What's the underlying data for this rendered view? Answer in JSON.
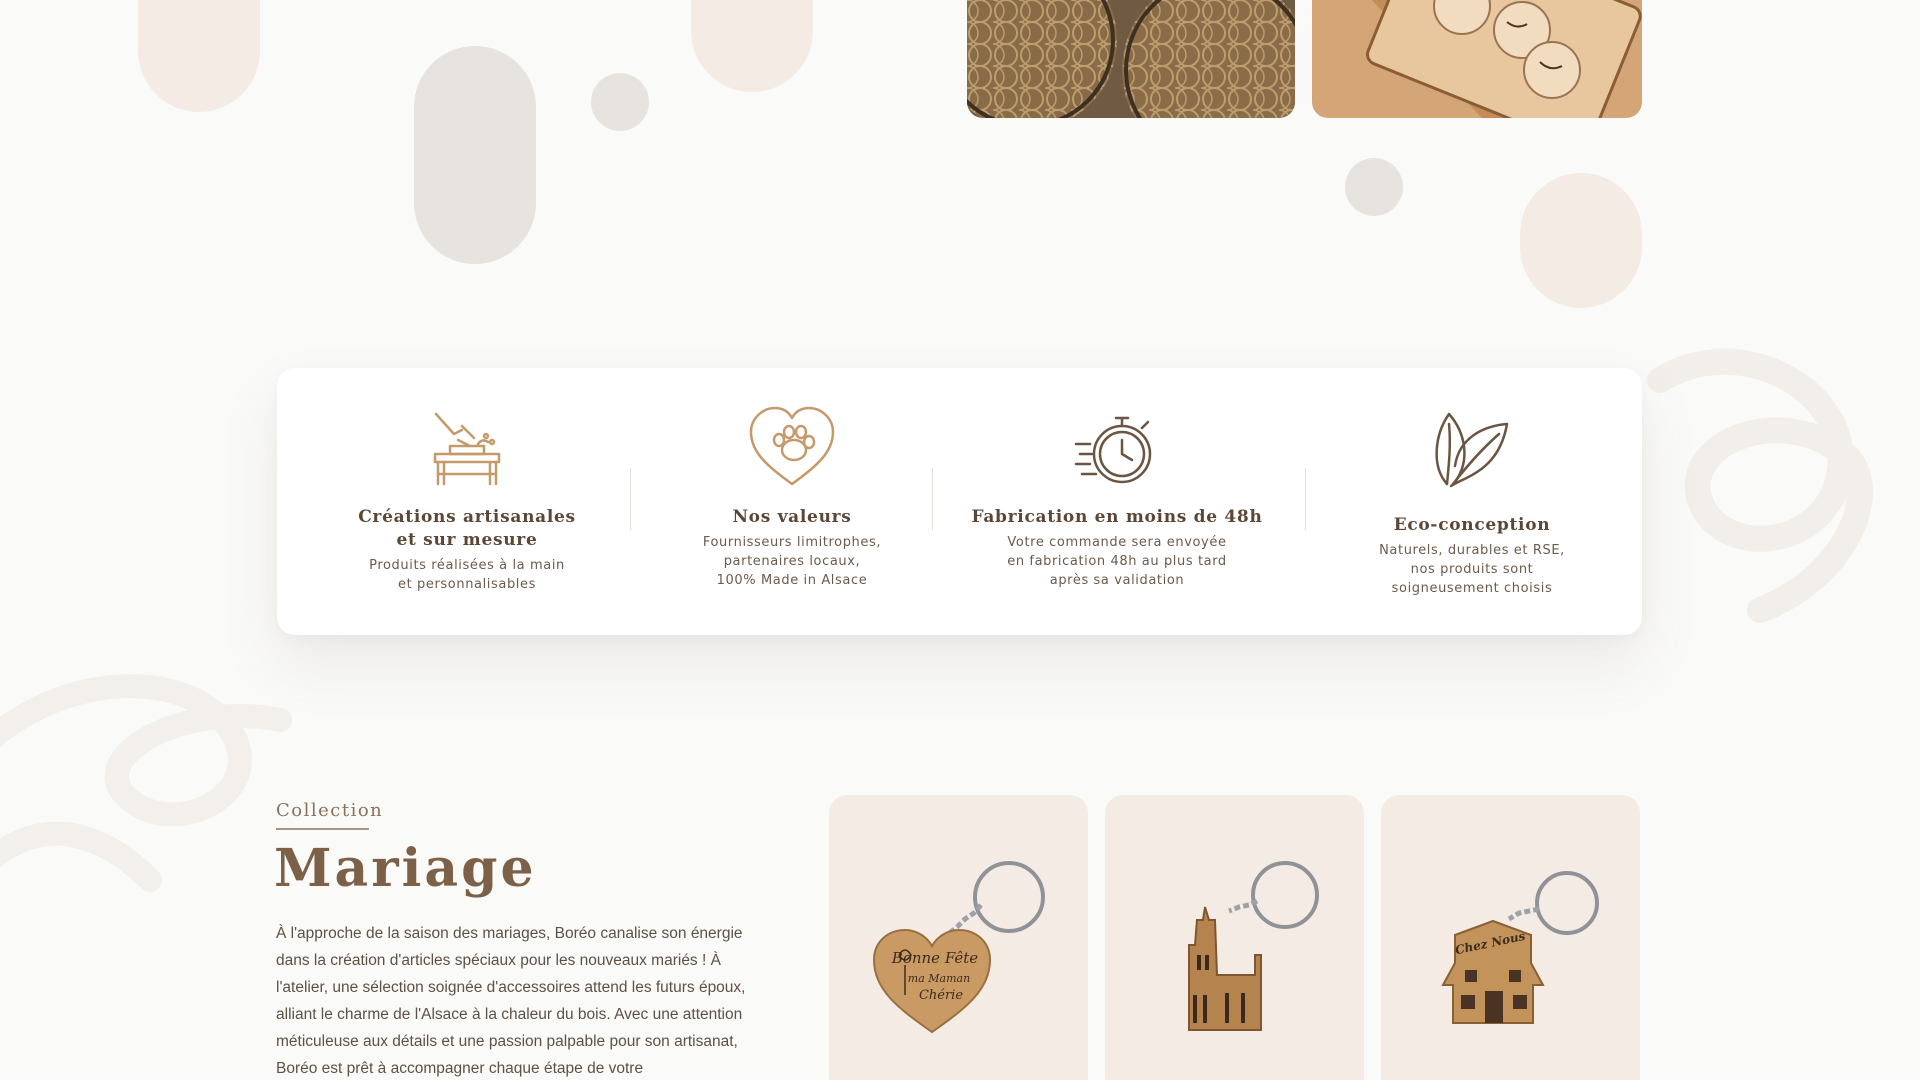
{
  "images": {
    "top_photo_1": "flower-of-life-wood-coasters",
    "top_photo_2": "engraved-wooden-tokens-in-tray"
  },
  "features": [
    {
      "icon": "carpentry-workbench-icon",
      "title": "Créations artisanales\net sur mesure",
      "text": "Produits réalisées à la main\net personnalisables"
    },
    {
      "icon": "heart-paw-icon",
      "title": "Nos valeurs",
      "text": "Fournisseurs limitrophes,\npartenaires locaux,\n100% Made in Alsace"
    },
    {
      "icon": "stopwatch-icon",
      "title": "Fabrication en moins de 48h",
      "text": "Votre commande sera envoyée\nen fabrication 48h au plus tard\naprès sa validation"
    },
    {
      "icon": "leaf-icon",
      "title": "Eco-conception",
      "text": "Naturels, durables et RSE,\nnos produits sont\nsoigneusement choisis"
    }
  ],
  "collection": {
    "eyebrow": "Collection",
    "title": "Mariage",
    "description": "À l'approche de la saison des mariages, Boréo canalise son énergie dans la création d'articles spéciaux pour les nouveaux mariés ! À l'atelier, une sélection soignée d'accessoires attend les futurs époux, alliant le charme de l'Alsace à la chaleur du bois. Avec une attention méticuleuse aux détails et une passion palpable pour son artisanat, Boréo est prêt à accompagner chaque étape de votre"
  },
  "products": [
    {
      "image": "heart-keychain-image",
      "engraving_lines": [
        "Bonne Fête",
        "ma Maman",
        "Chérie"
      ]
    },
    {
      "image": "cathedral-keychain-image"
    },
    {
      "image": "house-keychain-image",
      "engraving_lines": [
        "Chez Nous"
      ]
    }
  ],
  "colors": {
    "background": "#fafaf9",
    "card": "#ffffff",
    "product_bg": "#f4ebe4",
    "brand_brown": "#7c6148",
    "icon_gold": "#c59a6a",
    "icon_dark": "#6b5441"
  }
}
